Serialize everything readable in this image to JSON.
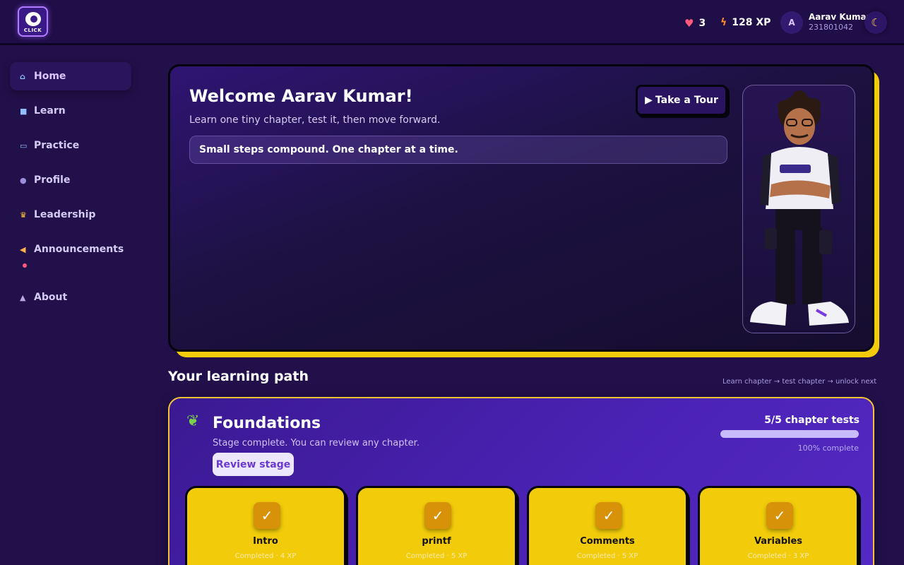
{
  "app": {
    "logo_text": "CLICK"
  },
  "header": {
    "hearts": "3",
    "xp": "128 XP",
    "avatar_initial": "A",
    "user_name": "Aarav Kumar",
    "user_id": "231801042",
    "heart_icon": "heart-icon",
    "xp_icon": "lightning-icon",
    "theme_icon": "moon-icon"
  },
  "nav": {
    "items": [
      {
        "label": "Home",
        "icon": "house-icon"
      },
      {
        "label": "Learn",
        "icon": "book-icon"
      },
      {
        "label": "Practice",
        "icon": "laptop-icon"
      },
      {
        "label": "Profile",
        "icon": "person-icon"
      },
      {
        "label": "Leadership",
        "icon": "trophy-icon"
      },
      {
        "label": "Announcements",
        "icon": "megaphone-icon"
      },
      {
        "label": "About",
        "icon": "graduation-cap-icon"
      }
    ]
  },
  "hero": {
    "title": "Welcome Aarav Kumar!",
    "subtitle": "Learn one tiny chapter, test it, then move forward.",
    "quote": "Small steps compound. One chapter at a time.",
    "tour_button": "Take a Tour"
  },
  "path": {
    "title": "Your learning path",
    "hint": "Learn chapter → test chapter → unlock next"
  },
  "stage": {
    "title": "Foundations",
    "subtitle": "Stage complete. You can review any chapter.",
    "review_button": "Review stage",
    "progress_label": "5/5 chapter tests",
    "progress_fraction": 1.0,
    "progress_pct": "100% complete",
    "chapters": [
      {
        "name": "Intro",
        "meta": "Completed · 4 XP"
      },
      {
        "name": "printf",
        "meta": "Completed · 5 XP"
      },
      {
        "name": "Comments",
        "meta": "Completed · 5 XP"
      },
      {
        "name": "Variables",
        "meta": "Completed · 3 XP"
      }
    ]
  },
  "colors": {
    "accent": "#f2cc0a",
    "background": "#22104a",
    "stage_border": "#f3c533"
  }
}
